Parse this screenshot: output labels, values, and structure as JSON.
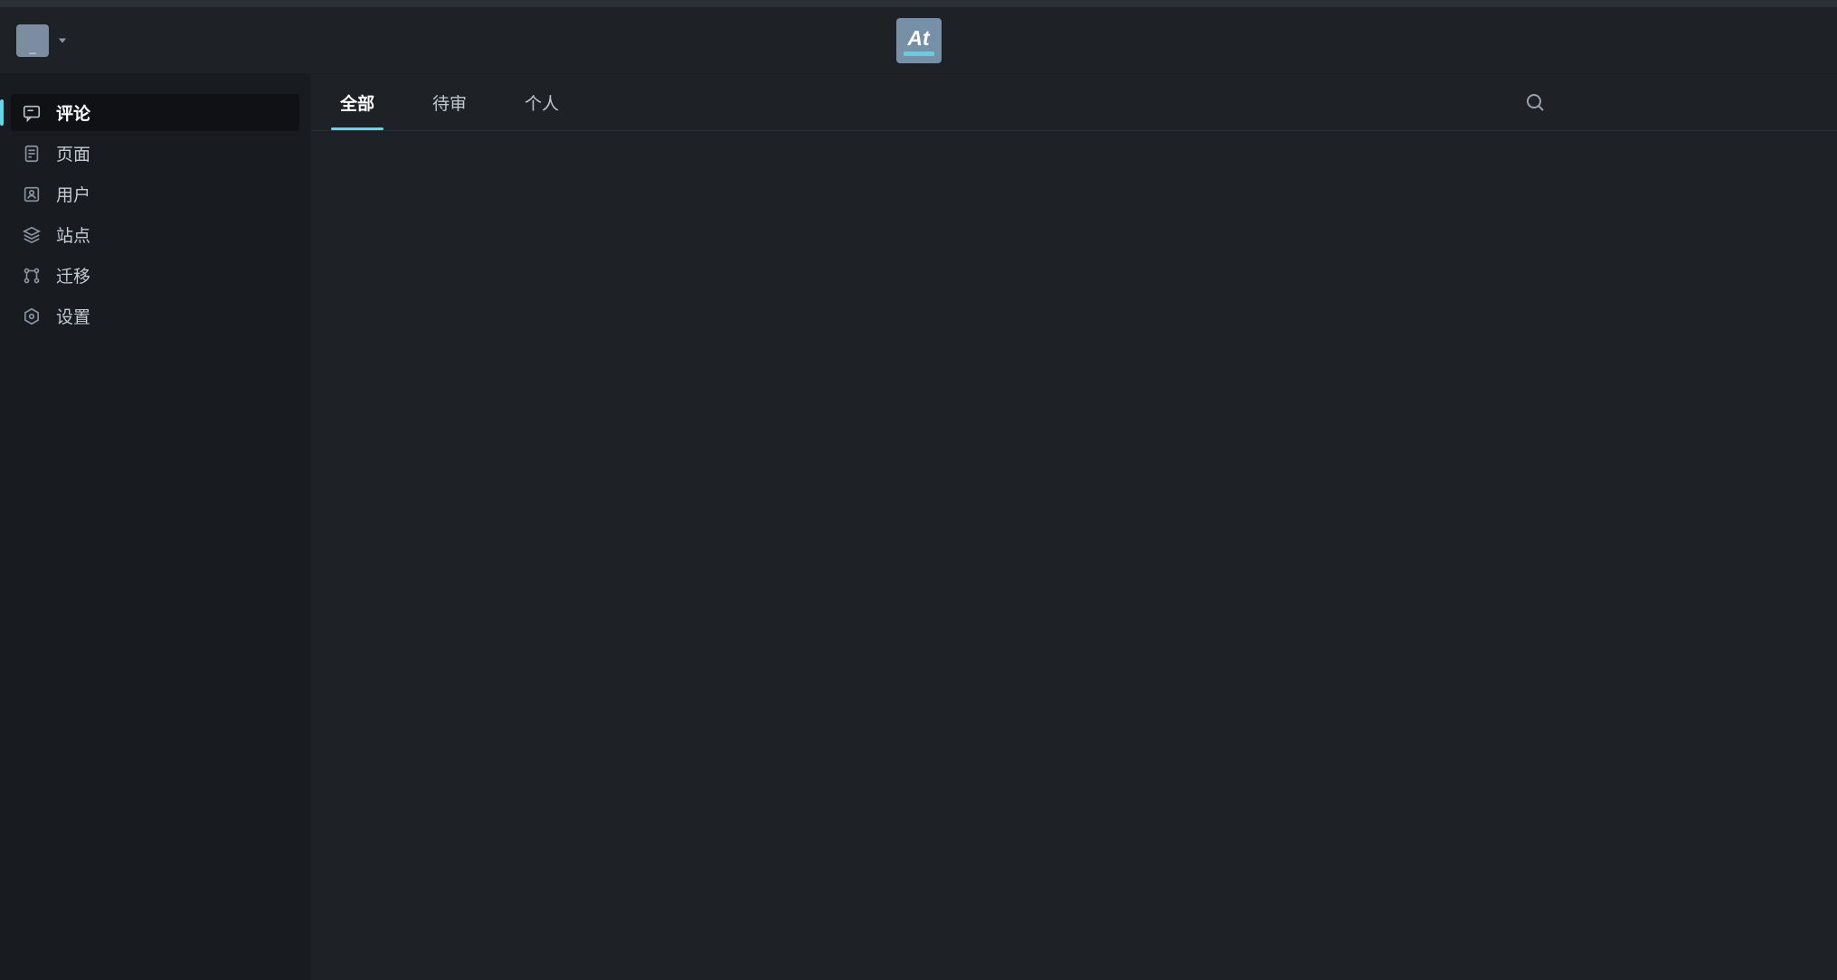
{
  "header": {
    "site_switcher_label": "_",
    "brand_text": "At"
  },
  "sidebar": {
    "items": [
      {
        "label": "评论",
        "active": true
      },
      {
        "label": "页面",
        "active": false
      },
      {
        "label": "用户",
        "active": false
      },
      {
        "label": "站点",
        "active": false
      },
      {
        "label": "迁移",
        "active": false
      },
      {
        "label": "设置",
        "active": false
      }
    ]
  },
  "main": {
    "tabs": [
      {
        "label": "全部",
        "active": true
      },
      {
        "label": "待审",
        "active": false
      },
      {
        "label": "个人",
        "active": false
      }
    ]
  }
}
